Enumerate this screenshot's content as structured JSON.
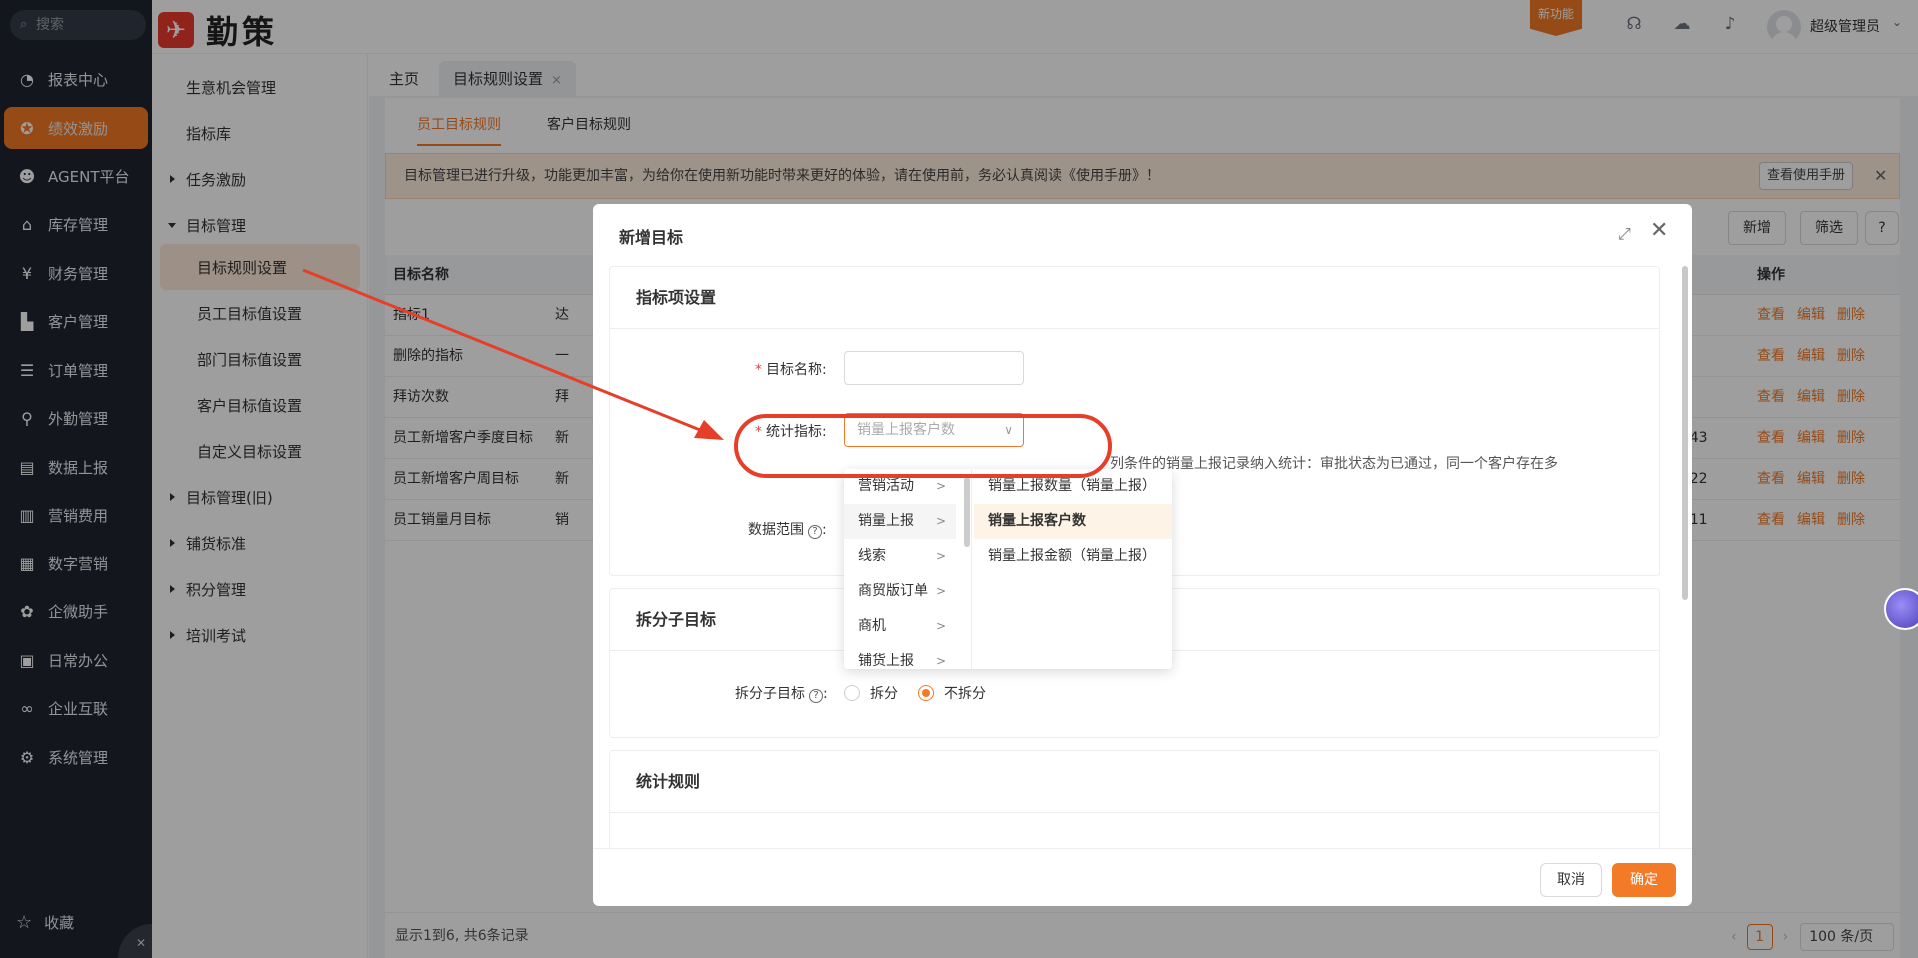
{
  "nav": {
    "search_placeholder": "搜索",
    "items": [
      {
        "label": "报表中心",
        "icon": "pie-chart-icon",
        "glyph": "◔"
      },
      {
        "label": "绩效激励",
        "icon": "award-icon",
        "glyph": "✪"
      },
      {
        "label": "AGENT平台",
        "icon": "robot-icon",
        "glyph": "☻"
      },
      {
        "label": "库存管理",
        "icon": "warehouse-icon",
        "glyph": "⌂"
      },
      {
        "label": "财务管理",
        "icon": "yen-icon",
        "glyph": "¥"
      },
      {
        "label": "客户管理",
        "icon": "customer-icon",
        "glyph": "▙"
      },
      {
        "label": "订单管理",
        "icon": "order-icon",
        "glyph": "☰"
      },
      {
        "label": "外勤管理",
        "icon": "location-icon",
        "glyph": "⚲"
      },
      {
        "label": "数据上报",
        "icon": "report-icon",
        "glyph": "▤"
      },
      {
        "label": "营销费用",
        "icon": "expense-icon",
        "glyph": "▥"
      },
      {
        "label": "数字营销",
        "icon": "store-icon",
        "glyph": "▦"
      },
      {
        "label": "企微助手",
        "icon": "wecom-icon",
        "glyph": "✿"
      },
      {
        "label": "日常办公",
        "icon": "briefcase-icon",
        "glyph": "▣"
      },
      {
        "label": "企业互联",
        "icon": "link-icon",
        "glyph": "∞"
      },
      {
        "label": "系统管理",
        "icon": "gear-icon",
        "glyph": "⚙"
      }
    ],
    "favorites": "收藏"
  },
  "header": {
    "brand": "勤策",
    "new_feature": "新功能",
    "username": "超级管理员"
  },
  "submenu": {
    "items": [
      {
        "label": "生意机会管理"
      },
      {
        "label": "指标库"
      },
      {
        "label": "任务激励"
      },
      {
        "label": "目标管理"
      },
      {
        "label": "目标规则设置"
      },
      {
        "label": "员工目标值设置"
      },
      {
        "label": "部门目标值设置"
      },
      {
        "label": "客户目标值设置"
      },
      {
        "label": "自定义目标设置"
      },
      {
        "label": "目标管理(旧)"
      },
      {
        "label": "铺货标准"
      },
      {
        "label": "积分管理"
      },
      {
        "label": "培训考试"
      }
    ]
  },
  "tabs": {
    "home": "主页",
    "current": "目标规则设置",
    "close": "×"
  },
  "subtabs": [
    "员工目标规则",
    "客户目标规则"
  ],
  "notice": {
    "text": "目标管理已进行升级，功能更加丰富，为给你在使用新功能时带来更好的体验，请在使用前，务必认真阅读《使用手册》！",
    "help_button": "查看使用手册",
    "close": "✕"
  },
  "toolbar": {
    "add": "新增",
    "filter": "筛选",
    "help": "?"
  },
  "table": {
    "col_name": "目标名称",
    "col_ops": "操作",
    "rows": [
      {
        "name": "指标1",
        "c2": "达",
        "time": ""
      },
      {
        "name": "删除的指标",
        "c2": "一",
        "time": ""
      },
      {
        "name": "拜访次数",
        "c2": "拜",
        "time": ""
      },
      {
        "name": "员工新增客户季度目标",
        "c2": "新",
        "time": ":43"
      },
      {
        "name": "员工新增客户周目标",
        "c2": "新",
        "time": ":22"
      },
      {
        "name": "员工销量月目标",
        "c2": "销",
        "time": ":11"
      }
    ],
    "ops": [
      "查看",
      "编辑",
      "删除"
    ]
  },
  "footer": {
    "summary": "显示1到6, 共6条记录",
    "page": "1",
    "page_size": "100 条/页"
  },
  "modal": {
    "title": "新增目标",
    "sections": {
      "indicator": "指标项设置",
      "split": "拆分子目标",
      "rules": "统计规则"
    },
    "fields": {
      "target_name_label": "目标名称:",
      "stat_label": "统计指标:",
      "stat_placeholder": "销量上报客户数",
      "range_label": "数据范围",
      "hint": "列条件的销量上报记录纳入统计：审批状态为已通过，同一个客户存在多",
      "split_label": "拆分子目标",
      "split_yes": "拆分",
      "split_no": "不拆分"
    },
    "cancel": "取消",
    "ok": "确定"
  },
  "cascader": {
    "level1": [
      "营销活动",
      "销量上报",
      "线索",
      "商贸版订单",
      "商机",
      "铺货上报"
    ],
    "level1_selected": 1,
    "level2": [
      "销量上报数量（销量上报）",
      "销量上报客户数",
      "销量上报金额（销量上报）"
    ],
    "level2_selected": 1
  },
  "colors": {
    "accent": "#f37a26",
    "sidebar": "#1f2430",
    "annotation": "#e53f2a"
  }
}
